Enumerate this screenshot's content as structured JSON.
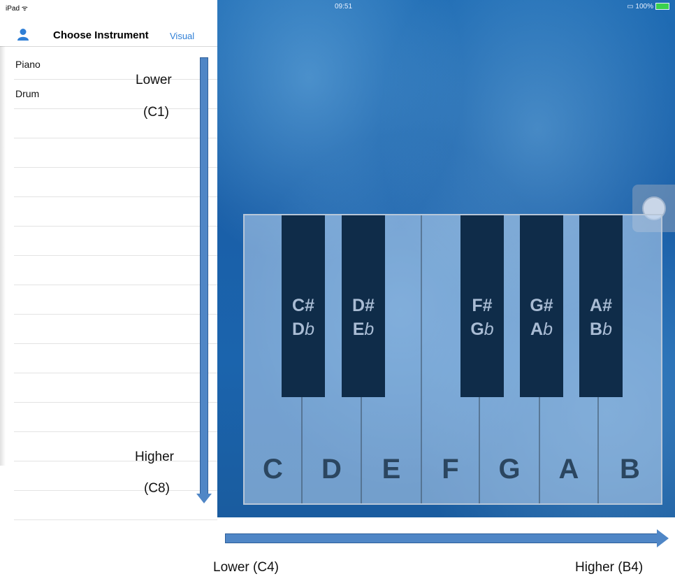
{
  "status": {
    "device": "iPad",
    "time": "09:51",
    "battery": "100%"
  },
  "nav": {
    "title": "Choose Instrument",
    "visual_label": "Visual"
  },
  "instruments": [
    {
      "label": "Piano"
    },
    {
      "label": "Drum"
    }
  ],
  "annotations": {
    "vertical_lower": "Lower",
    "vertical_lower_note": "(C1)",
    "vertical_higher": "Higher",
    "vertical_higher_note": "(C8)",
    "horizontal_lower": "Lower (C4)",
    "horizontal_higher": "Higher (B4)"
  },
  "piano": {
    "white_keys": [
      "C",
      "D",
      "E",
      "F",
      "G",
      "A",
      "B"
    ],
    "black_keys": [
      {
        "sharp": "C#",
        "flat_letter": "D",
        "flat_sign": "b"
      },
      {
        "sharp": "D#",
        "flat_letter": "E",
        "flat_sign": "b"
      },
      {
        "sharp": "F#",
        "flat_letter": "G",
        "flat_sign": "b"
      },
      {
        "sharp": "G#",
        "flat_letter": "A",
        "flat_sign": "b"
      },
      {
        "sharp": "A#",
        "flat_letter": "B",
        "flat_sign": "b"
      }
    ]
  },
  "colors": {
    "accent": "#2f7fd6",
    "arrow": "#4f86c6",
    "black_key": "#0f2c49"
  },
  "icons": {
    "user": "person-icon",
    "knob": "assistive-touch-icon"
  }
}
